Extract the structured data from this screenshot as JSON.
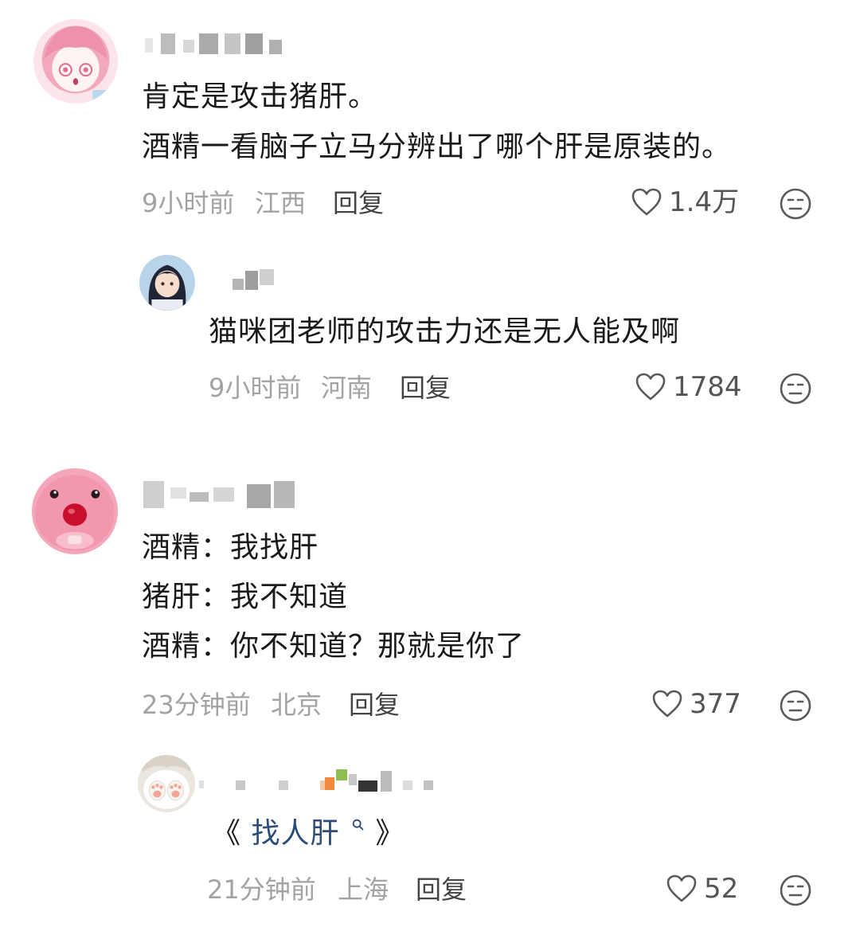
{
  "comments": [
    {
      "lines": [
        "肯定是攻击猪肝。",
        "酒精一看脑子立马分辨出了哪个肝是原装的。"
      ],
      "time": "9小时前",
      "location": "江西",
      "reply_label": "回复",
      "likes": "1.4万"
    },
    {
      "lines": [
        "猫咪团老师的攻击力还是无人能及啊"
      ],
      "time": "9小时前",
      "location": "河南",
      "reply_label": "回复",
      "likes": "1784"
    },
    {
      "lines": [
        "酒精：我找肝",
        "猪肝：我不知道",
        "酒精：你不知道？那就是你了"
      ],
      "time": "23分钟前",
      "location": "北京",
      "reply_label": "回复",
      "likes": "377"
    },
    {
      "link_open": "《",
      "link_text": "找人肝",
      "link_close": "》",
      "time": "21分钟前",
      "location": "上海",
      "reply_label": "回复",
      "likes": "52"
    }
  ],
  "icons": {
    "like": "heart-outline-icon",
    "dislike": "frown-face-icon",
    "search": "search-icon"
  },
  "colors": {
    "text": "#1a1a1a",
    "meta": "#a3a3a3",
    "reply": "#444444",
    "link": "#2d4c79"
  }
}
